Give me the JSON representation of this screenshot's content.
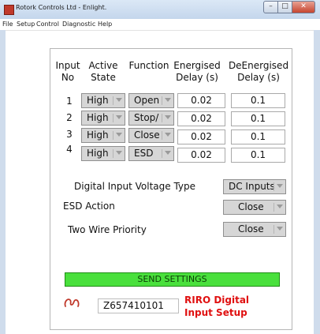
{
  "window": {
    "title": "Rotork Controls Ltd - Enlight."
  },
  "menu": [
    "File",
    "Setup",
    "Control",
    "Diagnostic",
    "Help"
  ],
  "headers": {
    "input": [
      "Input",
      "No"
    ],
    "active_state": [
      "Active",
      "State"
    ],
    "function": "Function",
    "energised": [
      "Energised",
      "Delay (s)"
    ],
    "deenergised": [
      "DeEnergised",
      "Delay (s)"
    ]
  },
  "rows": [
    {
      "no": "1",
      "state": "High",
      "function": "Open",
      "energised": "0.02",
      "deenergised": "0.1"
    },
    {
      "no": "2",
      "state": "High",
      "function": "Stop/",
      "energised": "0.02",
      "deenergised": "0.1"
    },
    {
      "no": "3",
      "state": "High",
      "function": "Close",
      "energised": "0.02",
      "deenergised": "0.1"
    },
    {
      "no": "4",
      "state": "High",
      "function": "ESD",
      "energised": "0.02",
      "deenergised": "0.1"
    }
  ],
  "settings": {
    "voltage_label": "Digital Input Voltage Type",
    "voltage_value": "DC Inputs",
    "esd_label": "ESD Action",
    "esd_value": "Close",
    "twowire_label": "Two Wire Priority",
    "twowire_value": "Close"
  },
  "send_button": "SEND SETTINGS",
  "serial": "Z657410101",
  "panel_title": [
    "RIRO Digital",
    "Input Setup"
  ],
  "colors": {
    "send": "#49e03c",
    "title_red": "#e01010"
  },
  "icons": {
    "app": "app-icon",
    "logo": "rotork-logo-icon",
    "dropdown": "chevron-down-icon"
  }
}
